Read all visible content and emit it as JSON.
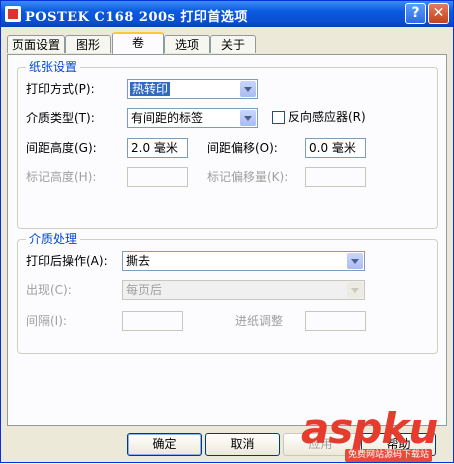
{
  "window": {
    "title": "POSTEK C168 200s 打印首选项",
    "help_glyph": "?",
    "close_glyph": "✕"
  },
  "tabs": [
    {
      "label": "页面设置"
    },
    {
      "label": "图形"
    },
    {
      "label": "卷",
      "active": true
    },
    {
      "label": "选项"
    },
    {
      "label": "关于"
    }
  ],
  "paper": {
    "group_title": "纸张设置",
    "print_mode_label": "打印方式(P):",
    "print_mode_value": "热转印",
    "media_type_label": "介质类型(T):",
    "media_type_value": "有间距的标签",
    "reverse_sensor_label": "反向感应器(R)",
    "reverse_sensor_checked": false,
    "gap_height_label": "间距高度(G):",
    "gap_height_value": "2.0 毫米",
    "gap_offset_label": "间距偏移(O):",
    "gap_offset_value": "0.0 毫米",
    "mark_height_label": "标记高度(H):",
    "mark_offset_label": "标记偏移量(K):"
  },
  "media": {
    "group_title": "介质处理",
    "post_print_label": "打印后操作(A):",
    "post_print_value": "撕去",
    "occurrence_label": "出现(C):",
    "occurrence_value": "每页后",
    "interval_label": "间隔(I):",
    "feed_adjust_label": "进纸调整"
  },
  "buttons": {
    "ok": "确定",
    "cancel": "取消",
    "apply": "应用",
    "help": "帮助"
  },
  "watermark": {
    "logo": "aspku",
    "tagline": "免费网站源码下载站"
  },
  "colors": {
    "title_bar": "#0a5ae0",
    "group_title": "#0046d5",
    "selection": "#316ac5",
    "watermark": "#e63c2d"
  }
}
